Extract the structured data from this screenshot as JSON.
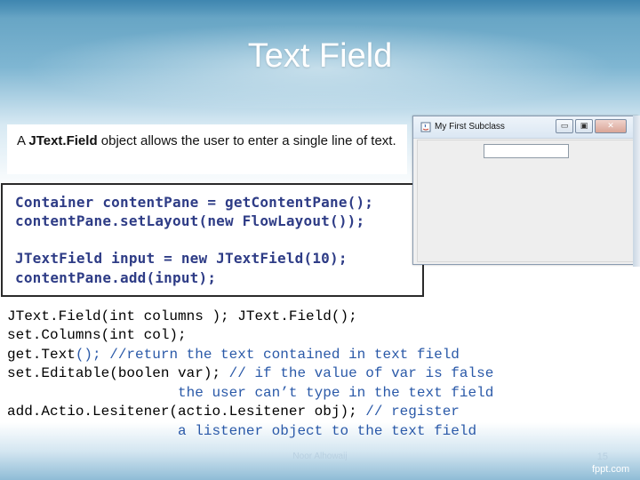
{
  "slide": {
    "title": "Text Field",
    "description_bold": "JText.Field",
    "description_prefix": "A ",
    "description_suffix": " object allows the user to enter a single line of text."
  },
  "code_panel": {
    "lines": [
      "Container contentPane = getContentPane();",
      "contentPane.setLayout(new FlowLayout());",
      "",
      "JTextField input = new JTextField(10);",
      "contentPane.add(input);"
    ]
  },
  "java_window": {
    "title": "My First Subclass",
    "minimize_glyph": "▭",
    "maximize_glyph": "▣",
    "close_glyph": "✕"
  },
  "api_lines": [
    {
      "code": "JText.Field(int columns ); JText.Field();",
      "comment": ""
    },
    {
      "code": "set.Columns(int col);",
      "comment": ""
    },
    {
      "code": "get.Text",
      "paren": "();",
      "comment": " //return the text contained in text field"
    },
    {
      "code": "set.Editable(boolen var);",
      "comment": " // if the value of var is false"
    },
    {
      "code": "",
      "comment": "                    the user can’t type in the text field"
    },
    {
      "code": "add.Actio.Lesitener(actio.Lesitener obj);",
      "comment": " // register"
    },
    {
      "code": "",
      "comment": "                    a listener object to the text field"
    }
  ],
  "footer": {
    "author": "Noor Alhowaij",
    "page_number": "15",
    "brand": "fppt.com"
  },
  "colors": {
    "title_text": "#ffffff",
    "code_text": "#2e3c86",
    "comment_text": "#2a59a8",
    "slide_band": "#5f9fc0"
  }
}
